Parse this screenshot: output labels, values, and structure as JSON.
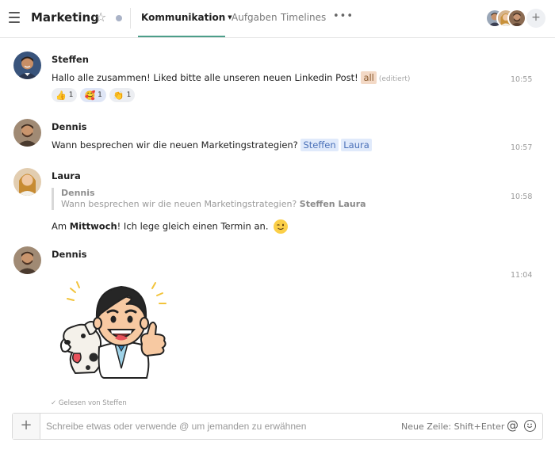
{
  "header": {
    "title": "Marketing",
    "tabs": [
      {
        "label": "Kommunikation",
        "active": true
      },
      {
        "label": "Aufgaben",
        "active": false
      },
      {
        "label": "Timelines",
        "active": false
      }
    ],
    "more_icon": "more-horizontal-icon",
    "add_member": "+"
  },
  "messages": [
    {
      "author": "Steffen",
      "text": "Hallo alle zusammen! Liked bitte alle unseren neuen Linkedin Post!",
      "mention": "all",
      "edited": "(editiert)",
      "time": "10:55",
      "reactions": [
        {
          "emoji": "👍",
          "count": "1"
        },
        {
          "emoji": "🥰",
          "count": "1"
        },
        {
          "emoji": "👏",
          "count": "1"
        }
      ]
    },
    {
      "author": "Dennis",
      "text": "Wann besprechen wir die neuen Marketingstrategien?",
      "mentions": [
        "Steffen",
        "Laura"
      ],
      "time": "10:57"
    },
    {
      "author": "Laura",
      "quote": {
        "author": "Dennis",
        "text": "Wann besprechen wir die neuen Marketingstrategien?",
        "mentions": "Steffen Laura"
      },
      "text_before": "Am",
      "text_bold": "Mittwoch",
      "text_after": "! Ich lege gleich einen Termin an.",
      "time": "10:58"
    },
    {
      "author": "Dennis",
      "sticker": "thumbs-up-sticker",
      "time": "11:04"
    }
  ],
  "read_receipt": "Gelesen von Steffen",
  "composer": {
    "placeholder": "Schreibe etwas oder verwende @ um jemanden zu erwähnen",
    "hint": "Neue Zeile: Shift+Enter",
    "at_symbol": "@"
  },
  "colors": {
    "accent": "#4c9e89",
    "mention_bg": "#e0eafb",
    "mention_text": "#4a70b8",
    "all_bg": "#f3d9c6"
  }
}
